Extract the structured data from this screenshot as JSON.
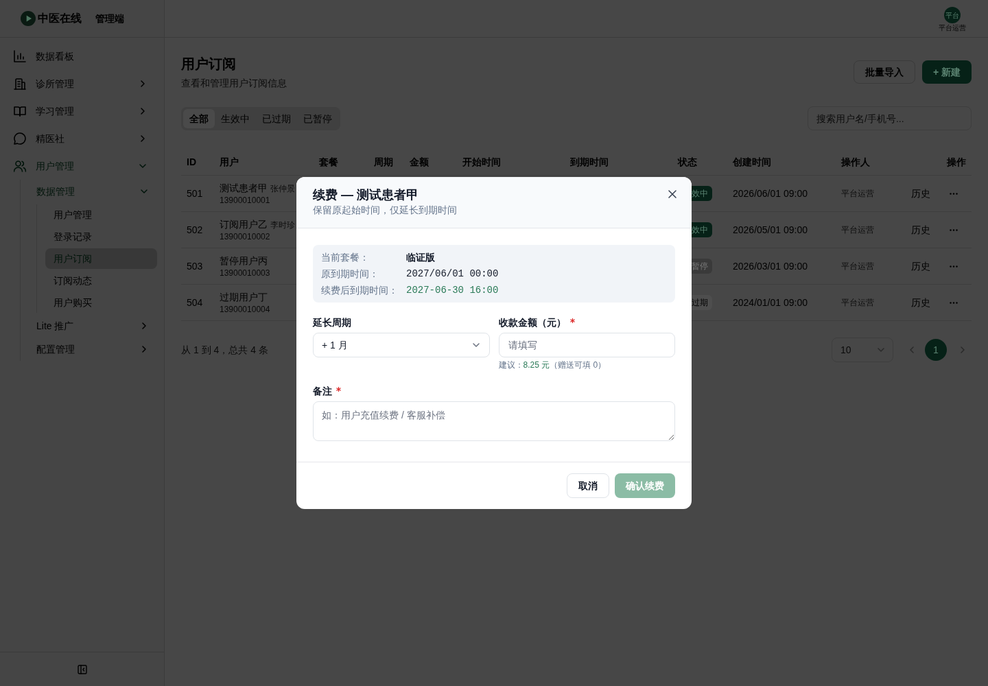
{
  "sidebar": {
    "brand": "中医在线",
    "brand_suffix": "管理端",
    "items": [
      {
        "label": "数据看板",
        "kind": "link",
        "selected": false
      },
      {
        "label": "诊所管理",
        "kind": "group",
        "expanded": false,
        "selected": false
      },
      {
        "label": "学习管理",
        "kind": "group",
        "expanded": false,
        "selected": false
      },
      {
        "label": "精医社",
        "kind": "group",
        "expanded": false,
        "selected": false
      },
      {
        "label": "用户管理",
        "kind": "group",
        "expanded": true,
        "selected": false,
        "children": [
          {
            "label": "数据管理",
            "kind": "group",
            "expanded": true,
            "selected": false,
            "children": [
              {
                "label": "用户管理",
                "kind": "link",
                "selected": false
              },
              {
                "label": "登录记录",
                "kind": "link",
                "selected": false
              },
              {
                "label": "用户订阅",
                "kind": "link",
                "selected": true
              },
              {
                "label": "订阅动态",
                "kind": "link",
                "selected": false
              },
              {
                "label": "用户购买",
                "kind": "link",
                "selected": false
              }
            ]
          },
          {
            "label": "Lite 推广",
            "kind": "group",
            "expanded": false,
            "selected": false
          },
          {
            "label": "配置管理",
            "kind": "group",
            "expanded": false,
            "selected": false
          }
        ]
      }
    ]
  },
  "header": {
    "avatar": "平台",
    "user_name": "平台运营"
  },
  "page": {
    "title": "用户订阅",
    "subtitle": "查看和管理用户订阅信息",
    "actions": [
      {
        "label": "批量导入",
        "kind": "secondary"
      },
      {
        "label": "+ 新建",
        "kind": "primary"
      }
    ],
    "tabs": [
      {
        "label": "全部",
        "selected": true
      },
      {
        "label": "生效中",
        "selected": false
      },
      {
        "label": "已过期",
        "selected": false
      },
      {
        "label": "已暂停",
        "selected": false
      }
    ],
    "search": {
      "placeholder": "搜索用户名/手机号..."
    }
  },
  "table": {
    "columns": [
      "ID",
      "用户",
      "套餐",
      "周期",
      "金额",
      "开始时间",
      "到期时间",
      "状态",
      "创建时间",
      "操作人",
      "操作"
    ],
    "rows": [
      {
        "id": "501",
        "name": "测试患者甲",
        "alias": "张仲景",
        "phone": "13900010001",
        "status": {
          "label": "效中",
          "kind": "active"
        },
        "created": "2026/06/01 09:00",
        "operator": "平台运营",
        "action": "历史"
      },
      {
        "id": "502",
        "name": "订阅用户乙",
        "alias": "李时珍",
        "phone": "13900010002",
        "status": {
          "label": "效中",
          "kind": "active"
        },
        "created": "2026/05/01 09:00",
        "operator": "平台运营",
        "action": "历史"
      },
      {
        "id": "503",
        "name": "暂停用户丙",
        "phone": "13900010003",
        "status": {
          "label": "暂停",
          "kind": "paused"
        },
        "created": "2026/03/01 09:00",
        "operator": "平台运营",
        "action": "历史"
      },
      {
        "id": "504",
        "name": "过期用户丁",
        "phone": "13900010004",
        "status": {
          "label": "过期",
          "kind": "expired"
        },
        "created": "2024/01/01 09:00",
        "operator": "平台运营",
        "action": "历史"
      }
    ]
  },
  "pagination": {
    "summary": "从 1 到 4，总共 4 条",
    "page_size": "10",
    "pages": [
      {
        "label": "1",
        "selected": true
      }
    ]
  },
  "dialog": {
    "title": "续费 — 测试患者甲",
    "subtitle": "保留原起始时间，仅延长到期时间",
    "info": [
      {
        "label": "当前套餐：",
        "value": "临证版",
        "kind": "plan"
      },
      {
        "label": "原到期时间：",
        "value": "2027/06/01 00:00",
        "kind": "date"
      },
      {
        "label": "续费后到期时间：",
        "value": "2027-06-30 16:00",
        "kind": "new_date"
      }
    ],
    "period": {
      "label": "延长周期",
      "required": false,
      "value": "+ 1 月"
    },
    "amount": {
      "label": "收款金额（元）",
      "required": true,
      "placeholder": "请填写",
      "hint": {
        "before": "建议：",
        "amount": "8.25 元",
        "after": "（赠送可填 0）"
      }
    },
    "note": {
      "label": "备注",
      "required": true,
      "placeholder": "如：用户充值续费 / 客服补偿"
    },
    "buttons": [
      {
        "label": "取消",
        "kind": "cancel",
        "disabled": false
      },
      {
        "label": "确认续费",
        "kind": "confirm",
        "disabled": true
      }
    ]
  }
}
